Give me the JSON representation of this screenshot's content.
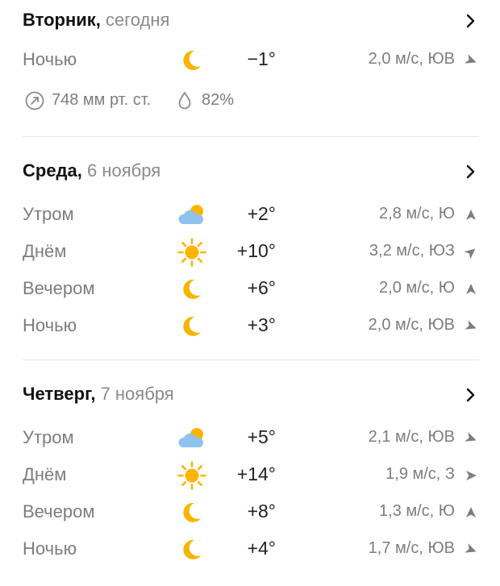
{
  "days": [
    {
      "title": "Вторник,",
      "date": "сегодня",
      "rows": [
        {
          "period": "Ночью",
          "icon": "moon-icon",
          "temp": "−1°",
          "wind": "2,0 м/с, ЮВ",
          "wind_dir": "SE"
        }
      ],
      "pressure": "748 мм рт. ст.",
      "humidity": "82%"
    },
    {
      "title": "Среда,",
      "date": "6 ноября",
      "rows": [
        {
          "period": "Утром",
          "icon": "cloud-sun-icon",
          "temp": "+2°",
          "wind": "2,8 м/с, Ю",
          "wind_dir": "S"
        },
        {
          "period": "Днём",
          "icon": "sun-icon",
          "temp": "+10°",
          "wind": "3,2 м/с, ЮЗ",
          "wind_dir": "SW"
        },
        {
          "period": "Вечером",
          "icon": "moon-icon",
          "temp": "+6°",
          "wind": "2,0 м/с, Ю",
          "wind_dir": "S"
        },
        {
          "period": "Ночью",
          "icon": "moon-icon",
          "temp": "+3°",
          "wind": "2,0 м/с, ЮВ",
          "wind_dir": "SE"
        }
      ]
    },
    {
      "title": "Четверг,",
      "date": "7 ноября",
      "rows": [
        {
          "period": "Утром",
          "icon": "cloud-sun-icon",
          "temp": "+5°",
          "wind": "2,1 м/с, ЮВ",
          "wind_dir": "SE"
        },
        {
          "period": "Днём",
          "icon": "sun-icon",
          "temp": "+14°",
          "wind": "1,9 м/с, З",
          "wind_dir": "W"
        },
        {
          "period": "Вечером",
          "icon": "moon-icon",
          "temp": "+8°",
          "wind": "1,3 м/с, Ю",
          "wind_dir": "S"
        },
        {
          "period": "Ночью",
          "icon": "moon-icon",
          "temp": "+4°",
          "wind": "1,7 м/с, ЮВ",
          "wind_dir": "SE"
        }
      ]
    }
  ],
  "colors": {
    "title": "#111111",
    "muted": "#7d7d7d",
    "moon": "#f7b500",
    "sun": "#ffb400",
    "cloud": "#8fc3ee",
    "divider": "#e6e6e6"
  }
}
